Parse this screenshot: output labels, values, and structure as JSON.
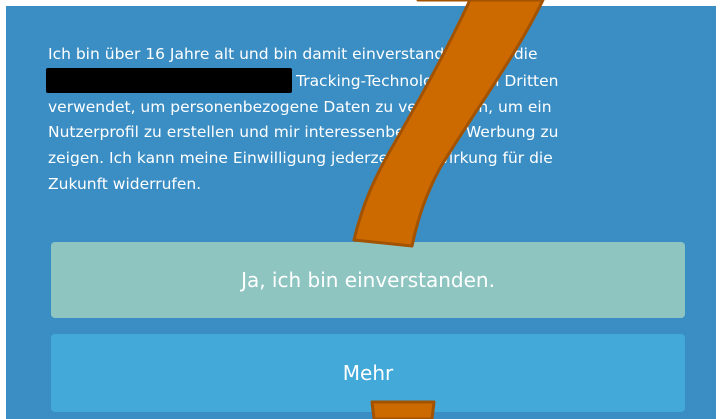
{
  "consent": {
    "line1": "Ich bin über 16 Jahre alt und bin damit einverstanden, dass die",
    "line2": "Tracking-Technologien von Dritten",
    "line3": "verwendet, um personenbezogene Daten zu verarbeiten, um ein",
    "line4": "Nutzerprofil zu erstellen und mir interessenbezogene Werbung zu",
    "line5": "zeigen. Ich kann meine Einwilligung jederzeit mit Wirkung für die",
    "line6": "Zukunft widerrufen."
  },
  "buttons": {
    "accept_label": "Ja, ich bin einverstanden.",
    "more_label": "Mehr"
  },
  "colors": {
    "panel_background": "#3b8ec4",
    "accept_button": "#8ec5c1",
    "more_button": "#42a9d9",
    "question_mark_overlay": "#cc6a00"
  },
  "icons": {
    "overlay": "question-mark-icon",
    "redaction": "redaction-block"
  }
}
